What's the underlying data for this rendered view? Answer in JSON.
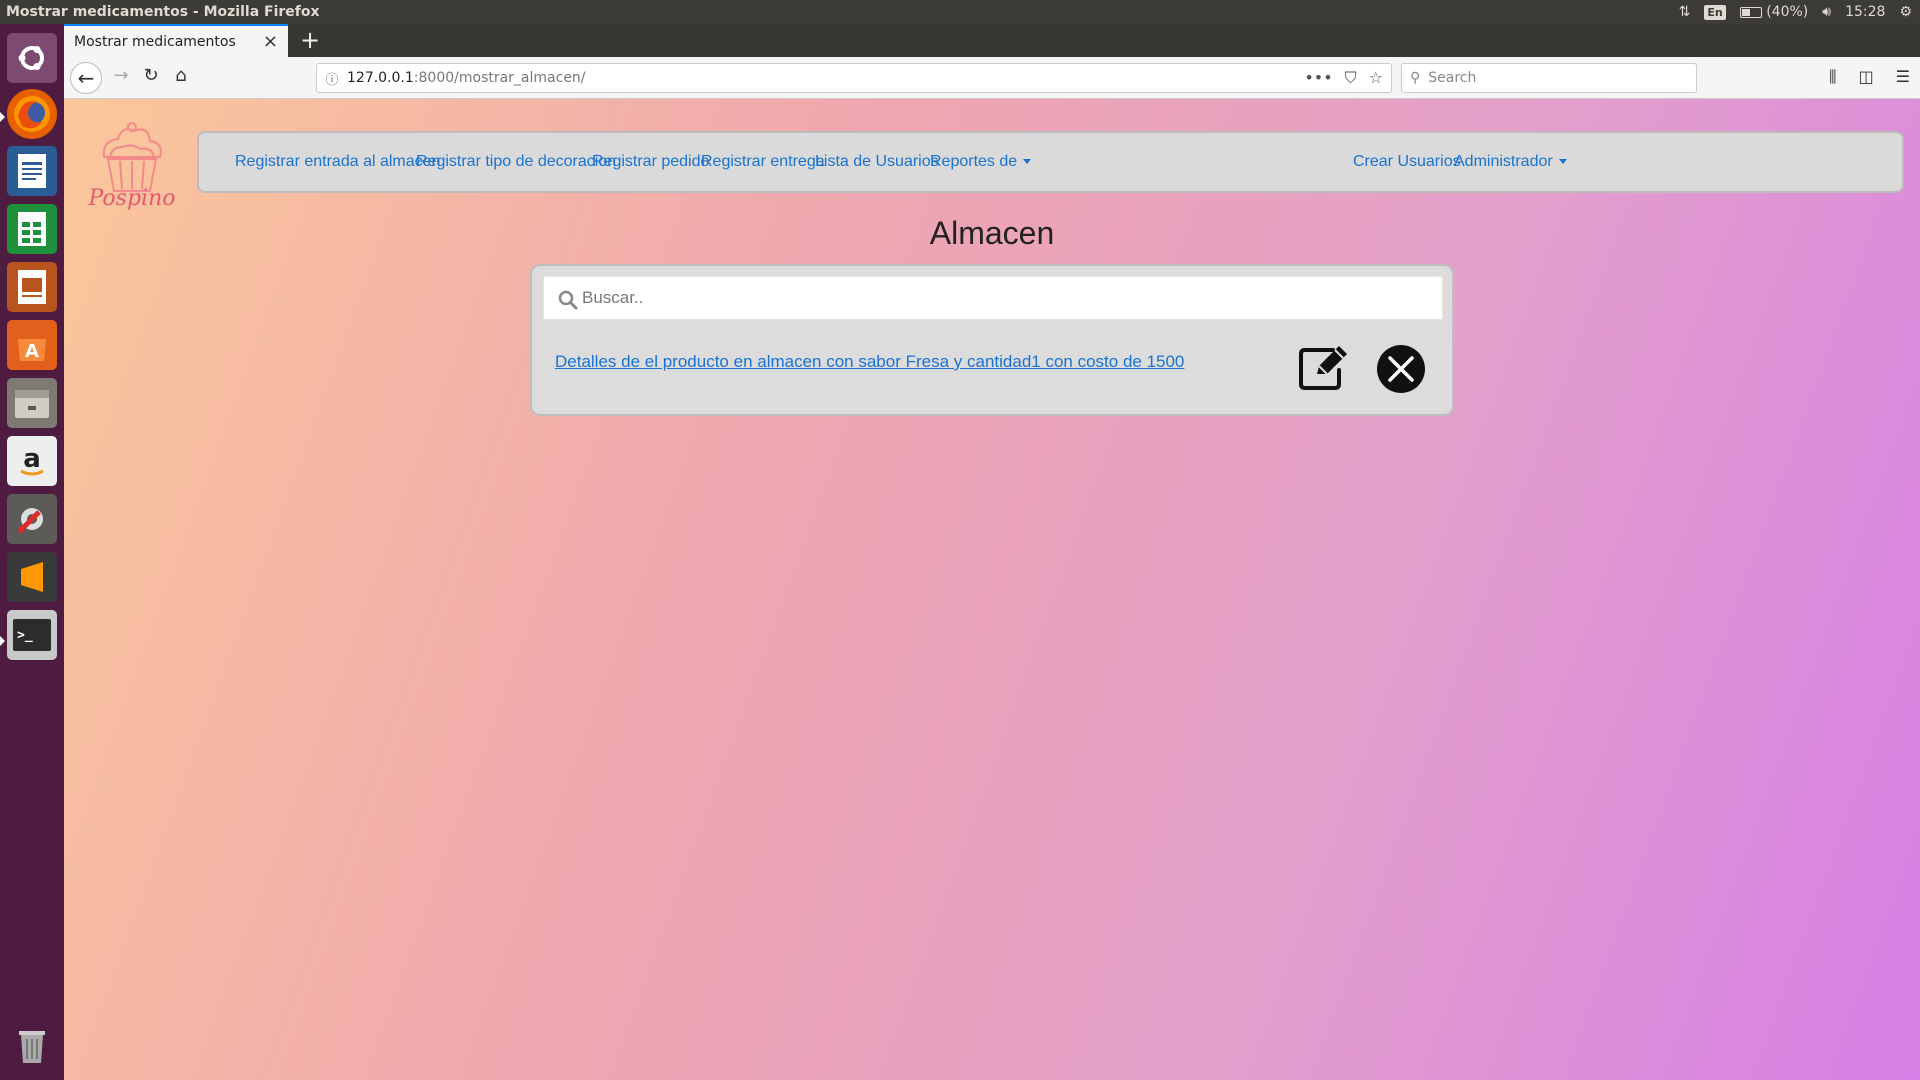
{
  "os": {
    "window_title": "Mostrar medicamentos - Mozilla Firefox",
    "keyboard_layout": "En",
    "battery": "(40%)",
    "clock": "15:28"
  },
  "launcher": {
    "apps": [
      "ubuntu-dash-icon",
      "firefox-icon",
      "writer-icon",
      "calc-icon",
      "impress-icon",
      "software-center-icon",
      "files-icon",
      "amazon-icon",
      "settings-icon",
      "sublime-text-icon",
      "terminal-icon",
      "trash-icon"
    ]
  },
  "browser": {
    "tab_title": "Mostrar medicamentos",
    "url_host": "127.0.0.1",
    "url_path": ":8000/mostrar_almacen/",
    "search_placeholder": "Search"
  },
  "navbar": {
    "left_links": [
      {
        "label": "Registrar entrada al almacen"
      },
      {
        "label": "Registrar tipo de decoracion"
      },
      {
        "label": "Registrar pedido"
      },
      {
        "label": "Registrar entrega"
      },
      {
        "label": "Lista de Usuarios"
      },
      {
        "label": "Reportes de"
      }
    ],
    "right_links": [
      {
        "label": "Crear Usuarios"
      },
      {
        "label": "Administrador"
      }
    ]
  },
  "logo": {
    "text": "Pospino"
  },
  "main": {
    "title": "Almacen",
    "search_placeholder": "Buscar..",
    "items": [
      {
        "text": "Detalles de el producto en almacen con sabor Fresa y cantidad1 con costo de 1500"
      }
    ]
  },
  "colors": {
    "link": "#1a73d1",
    "launcher": "#4d1c40",
    "gradient_start": "#fbc79a",
    "gradient_end": "#d67fe6"
  }
}
